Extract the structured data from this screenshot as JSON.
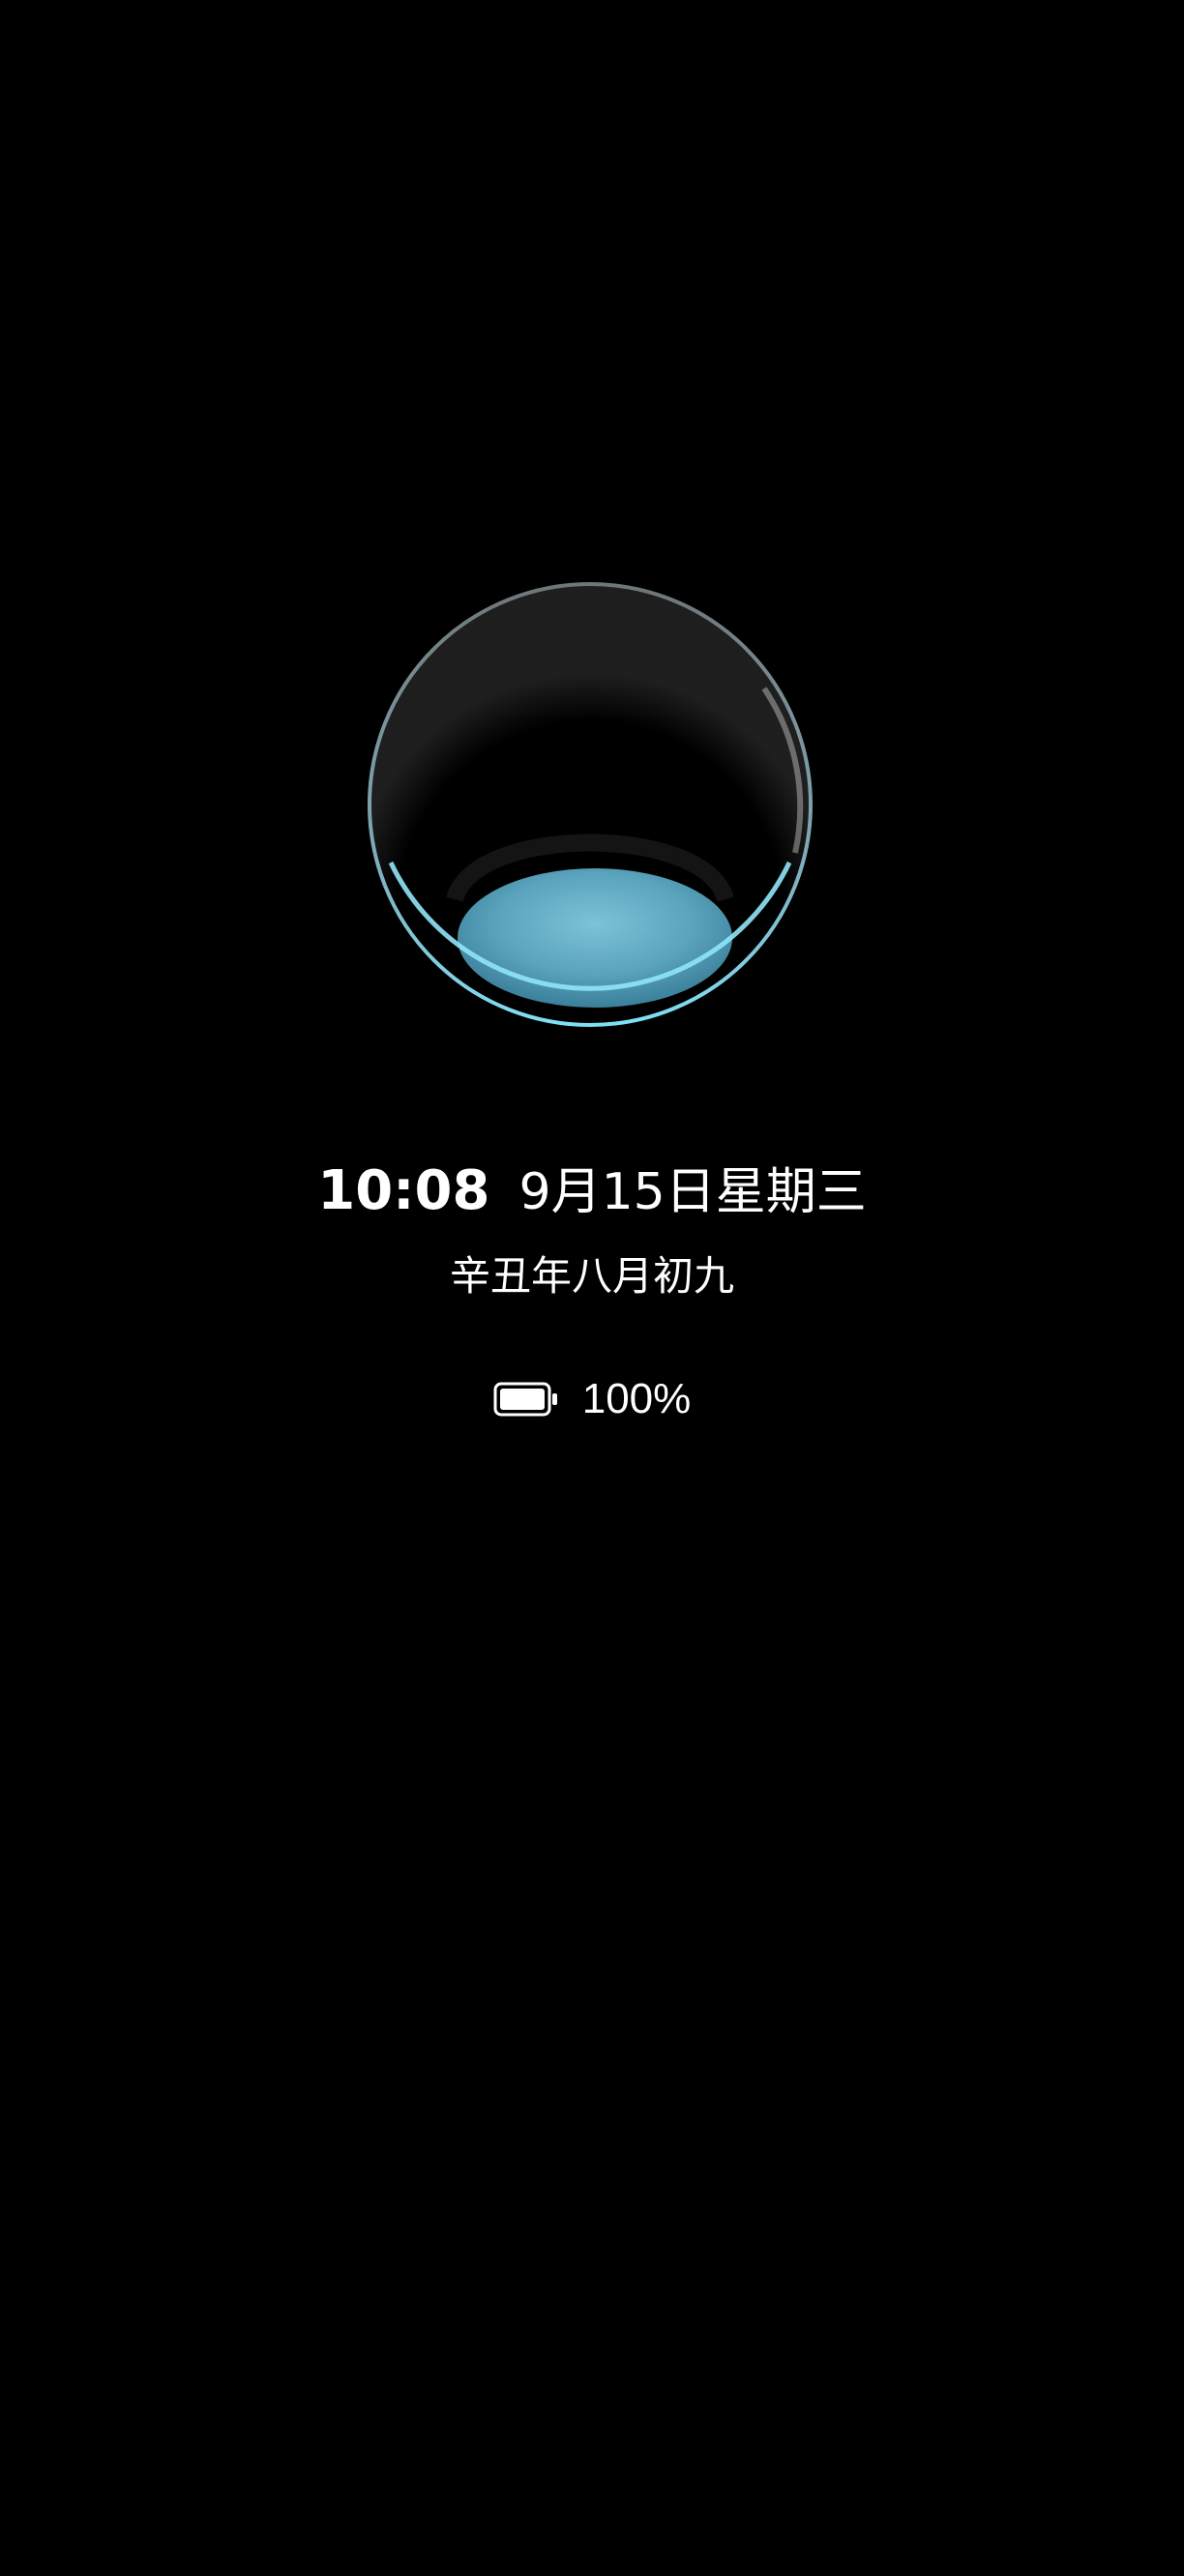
{
  "lockscreen": {
    "time": "10:08",
    "date": "9月15日星期三",
    "lunar_date": "辛丑年八月初九",
    "battery": {
      "percent_text": "100%",
      "level": 1.0,
      "icon": "battery-full-icon"
    },
    "wallpaper": {
      "icon": "glass-orb",
      "accent_color": "#5fb8d6"
    }
  }
}
